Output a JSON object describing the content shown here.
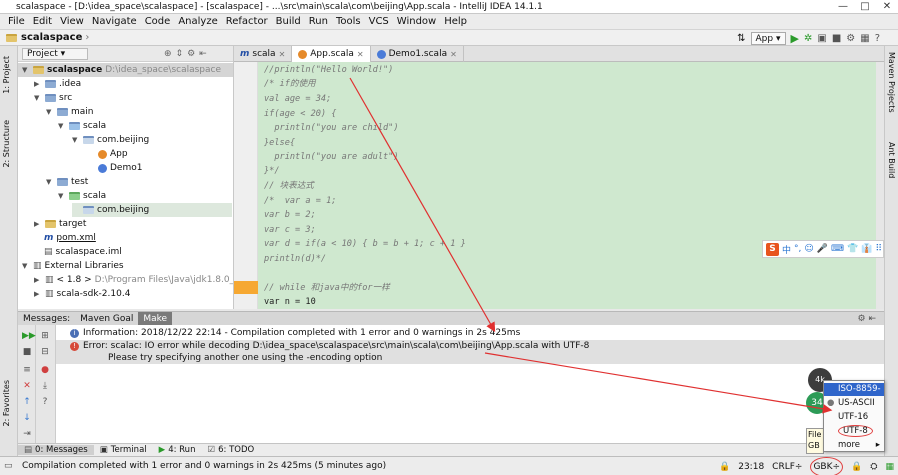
{
  "window": {
    "title": "scalaspace - [D:\\idea_space\\scalaspace] - [scalaspace] - ...\\src\\main\\scala\\com\\beijing\\App.scala - IntelliJ IDEA 14.1.1",
    "controls": [
      "—",
      "□",
      "✕"
    ]
  },
  "menu": [
    "File",
    "Edit",
    "View",
    "Navigate",
    "Code",
    "Analyze",
    "Refactor",
    "Build",
    "Run",
    "Tools",
    "VCS",
    "Window",
    "Help"
  ],
  "breadcrumb": "scalaspace",
  "run_config": "App",
  "left_tabs": {
    "project": "1: Project",
    "structure": "2: Structure",
    "favorites": "2: Favorites"
  },
  "right_tabs": {
    "maven": "Maven Projects",
    "ant": "Ant Build"
  },
  "project_panel": {
    "selector": "Project",
    "tree": [
      {
        "label": "scalaspace",
        "extra": "D:\\idea_space\\scalaspace",
        "bold": true
      },
      {
        "label": ".idea"
      },
      {
        "label": "src"
      },
      {
        "label": "main"
      },
      {
        "label": "scala"
      },
      {
        "label": "com.beijing"
      },
      {
        "label": "App"
      },
      {
        "label": "Demo1"
      },
      {
        "label": "test"
      },
      {
        "label": "scala"
      },
      {
        "label": "com.beijing"
      },
      {
        "label": "target"
      },
      {
        "label": "pom.xml"
      },
      {
        "label": "scalaspace.iml"
      },
      {
        "label": "External Libraries"
      },
      {
        "label": "< 1.8 >",
        "extra": "D:\\Program Files\\Java\\jdk1.8.0_141"
      },
      {
        "label": "scala-sdk-2.10.4"
      }
    ]
  },
  "editor": {
    "tabs": [
      {
        "label": "scala"
      },
      {
        "label": "App.scala"
      },
      {
        "label": "Demo1.scala"
      }
    ],
    "lines": [
      "//println(\"Hello World!\")",
      "/* if的使用",
      "val age = 34;",
      "if(age < 20) {",
      "  println(\"you are child\")",
      "}else{",
      "  println(\"you are adult\")",
      "}*/",
      "// 块表达式",
      "/*  var a = 1;",
      "var b = 2;",
      "var c = 3;",
      "var d = if(a < 10) { b = b + 1; c + 1 }",
      "println(d)*/",
      "",
      "// while 和java中的for一样",
      "var n = 10"
    ]
  },
  "ime_toolbar": {
    "logo": "S",
    "items": [
      "中",
      "°,",
      "☺",
      "🎤",
      "⌨",
      "👕",
      "👔",
      "⠿"
    ]
  },
  "messages": {
    "tabs": [
      "Messages:",
      "Maven Goal",
      "Make"
    ],
    "info": "Information: 2018/12/22 22:14 - Compilation completed with 1 error and 0 warnings in 2s 425ms",
    "error_line1": "Error: scalac: IO error while decoding D:\\idea_space\\scalaspace\\src\\main\\scala\\com\\beijing\\App.scala with UTF-8",
    "error_line2": "Please try specifying another one using the -encoding option"
  },
  "bottom_tabs": [
    "0: Messages",
    "Terminal",
    "4: Run",
    "6: TODO"
  ],
  "status": {
    "text": "Compilation completed with 1 error and 0 warnings in 2s 425ms (5 minutes ago)",
    "position": "23:18",
    "line_sep": "CRLF",
    "encoding": "GBK"
  },
  "encoding_popup": {
    "items": [
      "ISO-8859-1",
      "US-ASCII",
      "UTF-16",
      "UTF-8",
      "more"
    ],
    "selected": "ISO-8859-1"
  },
  "tooltip": {
    "line1": "File",
    "line2": "GB"
  },
  "badges": {
    "green": "34",
    "dark": "4k"
  }
}
